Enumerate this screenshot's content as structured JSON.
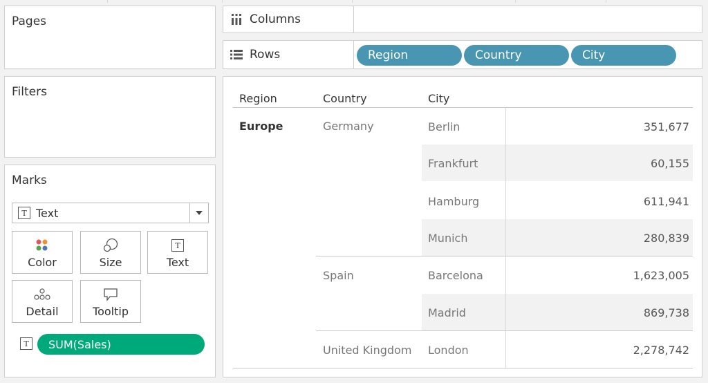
{
  "pages": {
    "title": "Pages"
  },
  "filters": {
    "title": "Filters"
  },
  "marks": {
    "title": "Marks",
    "mark_type": "Text",
    "buttons": {
      "color": "Color",
      "size": "Size",
      "text": "Text",
      "detail": "Detail",
      "tooltip": "Tooltip"
    },
    "pill": "SUM(Sales)"
  },
  "shelves": {
    "columns_label": "Columns",
    "rows_label": "Rows",
    "rows_pills": [
      "Region",
      "Country",
      "City"
    ]
  },
  "table": {
    "headers": {
      "region": "Region",
      "country": "Country",
      "city": "City"
    },
    "region": "Europe",
    "countries": [
      "Germany",
      "Spain",
      "United Kingdom"
    ],
    "rows": [
      {
        "city": "Berlin",
        "value": "351,677"
      },
      {
        "city": "Frankfurt",
        "value": "60,155"
      },
      {
        "city": "Hamburg",
        "value": "611,941"
      },
      {
        "city": "Munich",
        "value": "280,839"
      },
      {
        "city": "Barcelona",
        "value": "1,623,005"
      },
      {
        "city": "Madrid",
        "value": "869,738"
      },
      {
        "city": "London",
        "value": "2,278,742"
      }
    ]
  },
  "colors": {
    "dimension_pill": "#4996b2",
    "measure_pill": "#00a97a",
    "band": "#f2f2f2"
  }
}
